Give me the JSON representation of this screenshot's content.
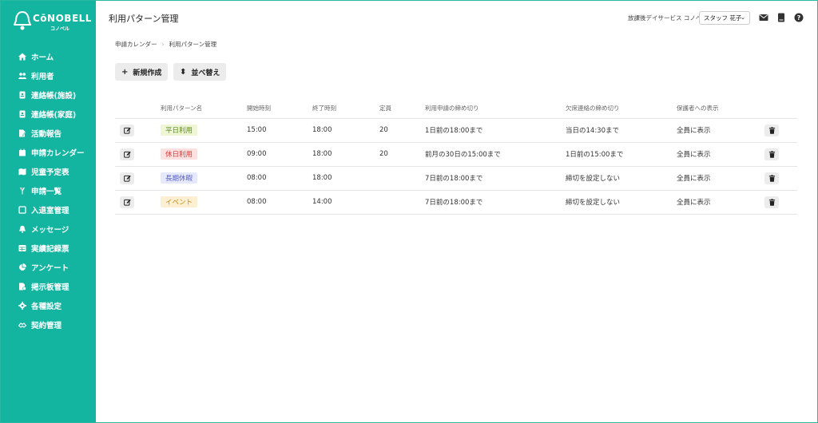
{
  "brand": {
    "name": "CōNOBELL",
    "sub": "コノベル"
  },
  "sidebar": {
    "items": [
      {
        "label": "ホーム",
        "icon": "home-icon"
      },
      {
        "label": "利用者",
        "icon": "users-icon"
      },
      {
        "label": "連絡帳(施設)",
        "icon": "contact-book-icon"
      },
      {
        "label": "連絡帳(家庭)",
        "icon": "contact-book-icon"
      },
      {
        "label": "活動報告",
        "icon": "report-icon"
      },
      {
        "label": "申請カレンダー",
        "icon": "calendar-icon"
      },
      {
        "label": "児童予定表",
        "icon": "map-icon"
      },
      {
        "label": "申請一覧",
        "icon": "list-icon"
      },
      {
        "label": "入退室管理",
        "icon": "door-icon"
      },
      {
        "label": "メッセージ",
        "icon": "bell-icon"
      },
      {
        "label": "実績記録票",
        "icon": "table-icon"
      },
      {
        "label": "アンケート",
        "icon": "pie-chart-icon"
      },
      {
        "label": "掲示板管理",
        "icon": "board-icon"
      },
      {
        "label": "各種設定",
        "icon": "gear-icon"
      },
      {
        "label": "契約管理",
        "icon": "handshake-icon"
      }
    ]
  },
  "header": {
    "title": "利用パターン管理",
    "facility": "放課後デイサービス コノベル",
    "user": "スタッフ 花子"
  },
  "breadcrumb": {
    "parent": "申請カレンダー",
    "current": "利用パターン管理"
  },
  "toolbar": {
    "new_label": "新規作成",
    "sort_label": "並べ替え"
  },
  "table": {
    "headers": {
      "name": "利用パターン名",
      "start": "開始時刻",
      "end": "終了時刻",
      "capacity": "定員",
      "deadline": "利用申請の締め切り",
      "absence": "欠席連絡の締め切り",
      "display": "保護者への表示"
    },
    "rows": [
      {
        "name": "平日利用",
        "tag_bg": "#eef6d6",
        "tag_fg": "#5c8a1a",
        "start": "15:00",
        "end": "18:00",
        "capacity": "20",
        "deadline": "1日前の18:00まで",
        "absence": "当日の14:30まで",
        "display": "全員に表示"
      },
      {
        "name": "休日利用",
        "tag_bg": "#fde0e0",
        "tag_fg": "#d63a3a",
        "start": "09:00",
        "end": "18:00",
        "capacity": "20",
        "deadline": "前月の30日の15:00まで",
        "absence": "1日前の15:00まで",
        "display": "全員に表示"
      },
      {
        "name": "長期休暇",
        "tag_bg": "#e6e8fb",
        "tag_fg": "#5a64c8",
        "start": "08:00",
        "end": "18:00",
        "capacity": "",
        "deadline": "7日前の18:00まで",
        "absence": "締切を設定しない",
        "display": "全員に表示"
      },
      {
        "name": "イベント",
        "tag_bg": "#fdf0d2",
        "tag_fg": "#c98a12",
        "start": "08:00",
        "end": "14:00",
        "capacity": "",
        "deadline": "7日前の18:00まで",
        "absence": "締切を設定しない",
        "display": "全員に表示"
      }
    ]
  },
  "colors": {
    "accent": "#14b5a0"
  }
}
